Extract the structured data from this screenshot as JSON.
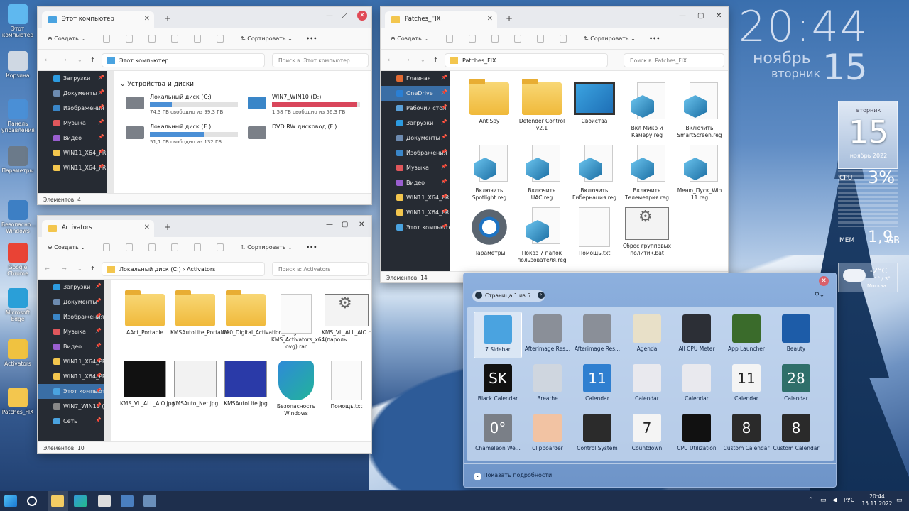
{
  "desktop": {
    "icons": [
      {
        "label": "Этот компьютер",
        "icon": "computer-icon"
      },
      {
        "label": "Корзина",
        "icon": "recycle-bin-icon"
      },
      {
        "label": "Панель управления",
        "icon": "control-panel-icon"
      },
      {
        "label": "Параметры",
        "icon": "settings-gear-icon"
      },
      {
        "label": "Безопасно... Windows",
        "icon": "windows-security-icon"
      },
      {
        "label": "Google Chrome",
        "icon": "chrome-icon"
      },
      {
        "label": "Microsoft Edge",
        "icon": "edge-icon"
      },
      {
        "label": "Activators",
        "icon": "key-icon"
      },
      {
        "label": "Patches_FIX",
        "icon": "folder-icon"
      }
    ]
  },
  "clock": {
    "time": "20:44",
    "month": "ноябрь",
    "weekday": "вторник",
    "day": "15"
  },
  "side_gadgets": {
    "calendar": {
      "weekday": "вторник",
      "day": "15",
      "month_year": "ноябрь 2022"
    },
    "cpu": {
      "label": "CPU",
      "value": "3%"
    },
    "mem": {
      "label": "MEM",
      "value": "1,9",
      "unit": "GB"
    },
    "weather": {
      "temp": "-2°C",
      "range": "1° / 3°",
      "city": "Москва"
    }
  },
  "win_pc": {
    "tab": "Этот компьютер",
    "toolbar": {
      "create": "Создать",
      "sort": "Сортировать",
      "more": "•••"
    },
    "path": "Этот компьютер",
    "search": "Поиск в: Этот компьютер",
    "nav": [
      "Загрузки",
      "Документы",
      "Изображения",
      "Музыка",
      "Видео",
      "WIN11_X64_PRO_",
      "WIN11_X64_PRO_"
    ],
    "section": "Устройства и диски",
    "drives": [
      {
        "name": "Локальный диск (C:)",
        "free": "74,3 ГБ свободно из 99,3 ГБ",
        "used": 0.25
      },
      {
        "name": "WIN7_WIN10 (D:)",
        "free": "1,58 ГБ свободно из 56,3 ГБ",
        "used": 0.97
      },
      {
        "name": "Локальный диск (E:)",
        "free": "51,1 ГБ свободно из 132 ГБ",
        "used": 0.61
      },
      {
        "name": "DVD RW дисковод (F:)",
        "free": "",
        "used": 0
      }
    ],
    "status": "Элементов: 4"
  },
  "win_act": {
    "tab": "Activators",
    "toolbar": {
      "create": "Создать",
      "sort": "Сортировать",
      "more": "•••"
    },
    "path": [
      "Локальный диск (C:)",
      "Activators"
    ],
    "search": "Поиск в: Activators",
    "nav": [
      "Загрузки",
      "Документы",
      "Изображения",
      "Музыка",
      "Видео",
      "WIN11_X64_PRO_",
      "WIN11_X64_PRO_",
      "Этот компьютер",
      "WIN7_WIN10 (D",
      "Сеть"
    ],
    "files": [
      {
        "name": "AAct_Portable",
        "type": "folder"
      },
      {
        "name": "KMSAutoLite_Portable",
        "type": "folder"
      },
      {
        "name": "W10_Digital_Activation_Program",
        "type": "folder"
      },
      {
        "name": "KMS_Activators_x64(пароль ovg).rar",
        "type": "doc"
      },
      {
        "name": "KMS_VL_ALL_AIO.cmd",
        "type": "bat"
      },
      {
        "name": "KMS_VL_ALL_AIO.jpg",
        "type": "img-dark"
      },
      {
        "name": "KMSAuto_Net.jpg",
        "type": "img-light"
      },
      {
        "name": "KMSAutoLite.jpg",
        "type": "img-blue"
      },
      {
        "name": "Безопасность Windows",
        "type": "shield"
      },
      {
        "name": "Помощь.txt",
        "type": "doc"
      }
    ],
    "status": "Элементов: 10"
  },
  "win_patch": {
    "tab": "Patches_FIX",
    "toolbar": {
      "create": "Создать",
      "sort": "Сортировать",
      "more": "•••"
    },
    "path": "Patches_FIX",
    "search": "Поиск в: Patches_FIX",
    "nav": [
      "Главная",
      "OneDrive",
      "Рабочий стол",
      "Загрузки",
      "Документы",
      "Изображения",
      "Музыка",
      "Видео",
      "WIN11_X64_PRO_",
      "WIN11_X64_PRO_",
      "Этот компьютер"
    ],
    "files": [
      {
        "name": "AntiSpy",
        "type": "folder"
      },
      {
        "name": "Defender Control v2.1",
        "type": "folder"
      },
      {
        "name": "Свойства",
        "type": "monitor"
      },
      {
        "name": "Вкл Микр и Камеру.reg",
        "type": "reg"
      },
      {
        "name": "Включить SmartScreen.reg",
        "type": "reg"
      },
      {
        "name": "Включить Spotlight.reg",
        "type": "reg"
      },
      {
        "name": "Включить UAC.reg",
        "type": "reg"
      },
      {
        "name": "Включить Гибернация.reg",
        "type": "reg"
      },
      {
        "name": "Включить Телеметрия.reg",
        "type": "reg"
      },
      {
        "name": "Меню_Пуск_Win 11.reg",
        "type": "reg"
      },
      {
        "name": "Параметры",
        "type": "gear"
      },
      {
        "name": "Показ 7 папок пользователя.reg",
        "type": "reg"
      },
      {
        "name": "Помощь.txt",
        "type": "doc"
      },
      {
        "name": "Сброс групповых политик.bat",
        "type": "bat"
      }
    ],
    "status": "Элементов: 14"
  },
  "gadgets": {
    "page": "Страница 1 из 5",
    "items": [
      "7 Sidebar",
      "Afterimage Res...",
      "Afterimage Res...",
      "Agenda",
      "All CPU Meter",
      "App Launcher",
      "Beauty",
      "Black Calendar",
      "Breathe",
      "Calendar",
      "Calendar",
      "Calendar",
      "Calendar",
      "Calendar",
      "Chameleon We...",
      "Clipboarder",
      "Control System",
      "Countdown",
      "CPU Utilization",
      "Custom Calendar",
      "Custom Calendar"
    ],
    "details": "Показать подробности",
    "colors": [
      "#4aa3e0",
      "#8a8f98",
      "#8a8f98",
      "#e8e0c8",
      "#2c2f36",
      "#3a6b2b",
      "#1d5ca8",
      "#111111",
      "#cfd6df",
      "#2f7fd0",
      "#e9e9ee",
      "#e9e9ee",
      "#f4f4f4",
      "#2f6f6a",
      "#7a7f87",
      "#f2c3a3",
      "#2b2b2b",
      "#f4f4f4",
      "#111111",
      "#2a2a2a",
      "#2a2a2a"
    ],
    "labels": [
      "",
      "",
      "",
      "",
      "",
      "",
      "",
      "SK",
      "",
      "11",
      "",
      "",
      "11",
      "28",
      "0°",
      "",
      "",
      "7",
      "",
      "8",
      "8"
    ]
  },
  "taskbar": {
    "lang": "РУС",
    "time": "20:44",
    "date": "15.11.2022"
  }
}
